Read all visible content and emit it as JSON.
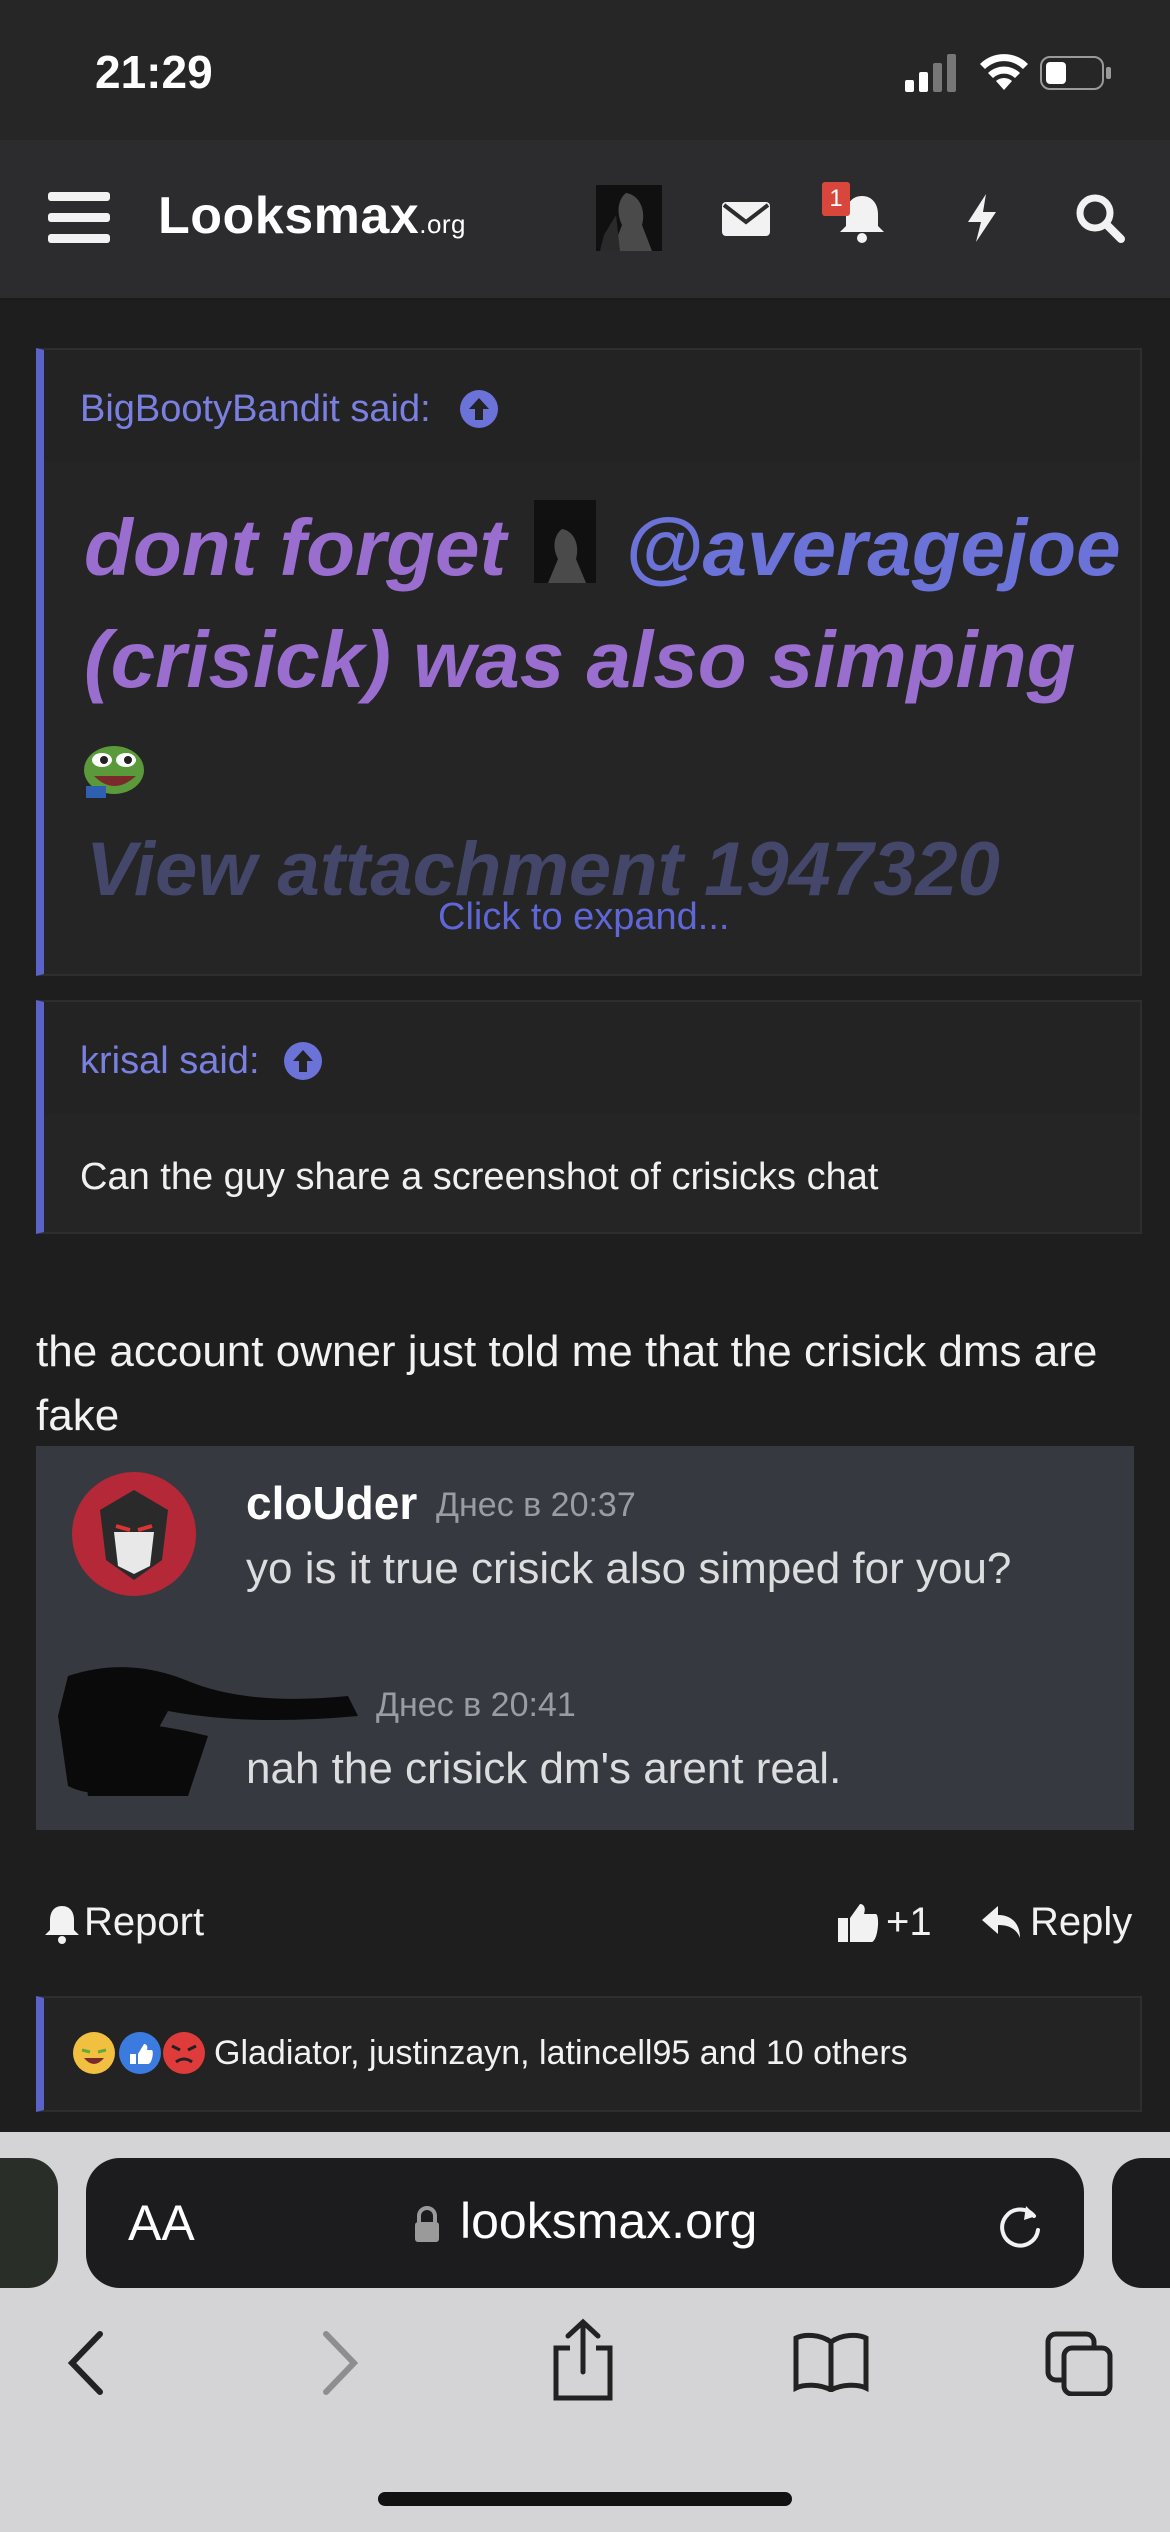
{
  "status_bar": {
    "time": "21:29"
  },
  "header": {
    "logo_main": "Looksmax",
    "logo_suffix": ".org",
    "notifications_badge": "1"
  },
  "quotes": [
    {
      "author_label": "BigBootyBandit said:",
      "text_part1": "dont forget",
      "mention": "@averagejoe",
      "text_part2": "(crisick) was also simping",
      "attachment": "View attachment 1947320",
      "expand_label": "Click to expand..."
    },
    {
      "author_label": "krisal said:",
      "text": "Can the guy share a screenshot of crisicks chat"
    }
  ],
  "post": {
    "text": "the account owner just told me that the crisick dms are fake"
  },
  "discord": {
    "messages": [
      {
        "name": "cloUder",
        "timestamp": "Днес в 20:37",
        "text": "yo is it true crisick also simped for you?"
      },
      {
        "name": "",
        "timestamp": "Днес в 20:41",
        "text": "nah the crisick dm's arent real."
      }
    ]
  },
  "actions": {
    "report_label": "Report",
    "like_label": "+1",
    "reply_label": "Reply"
  },
  "reactions": {
    "text": "Gladiator, justinzayn, latincell95 and 10 others"
  },
  "browser": {
    "text_size_label": "AA",
    "url": "looksmax.org"
  },
  "colors": {
    "accent": "#5b62c8",
    "quote_text": "#9a6ecf",
    "badge": "#d9463b",
    "discord_bg": "#36393f"
  }
}
